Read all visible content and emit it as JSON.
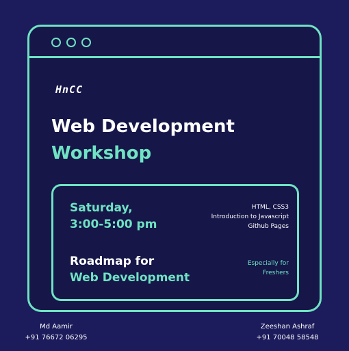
{
  "logo": {
    "text": "HnCC"
  },
  "title": {
    "line1": "Web Development",
    "line2": "Workshop"
  },
  "schedule": {
    "day": "Saturday,",
    "time": "3:00-5:00 pm"
  },
  "topics": [
    "HTML, CSS3",
    "Introduction to Javascript",
    "Github Pages"
  ],
  "roadmap": {
    "line1": "Roadmap for",
    "line2": "Web Development"
  },
  "audience": {
    "line1": "Especially for",
    "line2": "Freshers"
  },
  "contacts": [
    {
      "name": "Md Aamir",
      "phone": "+91 76672 06295"
    },
    {
      "name": "Zeeshan Ashraf",
      "phone": "+91 70048 58548"
    }
  ],
  "colors": {
    "background": "#1c1b5b",
    "accent": "#6fe3c3",
    "text": "#ffffff"
  }
}
